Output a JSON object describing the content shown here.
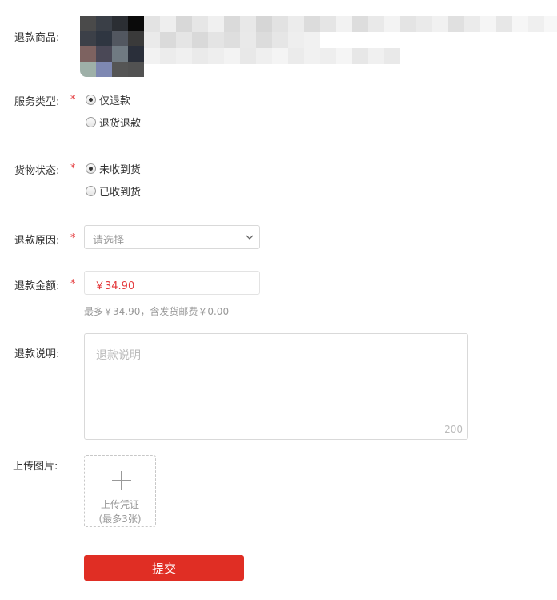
{
  "form": {
    "product_label": "退款商品:",
    "service_label": "服务类型:",
    "service_options": [
      {
        "label": "仅退款",
        "checked": true
      },
      {
        "label": "退货退款",
        "checked": false
      }
    ],
    "goods_label": "货物状态:",
    "goods_options": [
      {
        "label": "未收到货",
        "checked": true
      },
      {
        "label": "已收到货",
        "checked": false
      }
    ],
    "reason_label": "退款原因:",
    "reason_placeholder": "请选择",
    "amount_label": "退款金额:",
    "amount_value": "￥34.90",
    "amount_hint": "最多￥34.90，含发货邮费￥0.00",
    "desc_label": "退款说明:",
    "desc_placeholder": "退款说明",
    "desc_max": "200",
    "upload_label": "上传图片:",
    "upload_text": "上传凭证",
    "upload_limit": "(最多3张)",
    "submit_label": "提交",
    "required_mark": "*"
  },
  "colors": {
    "accent": "#e02e24",
    "required": "#e4393c",
    "placeholder": "#999999"
  }
}
